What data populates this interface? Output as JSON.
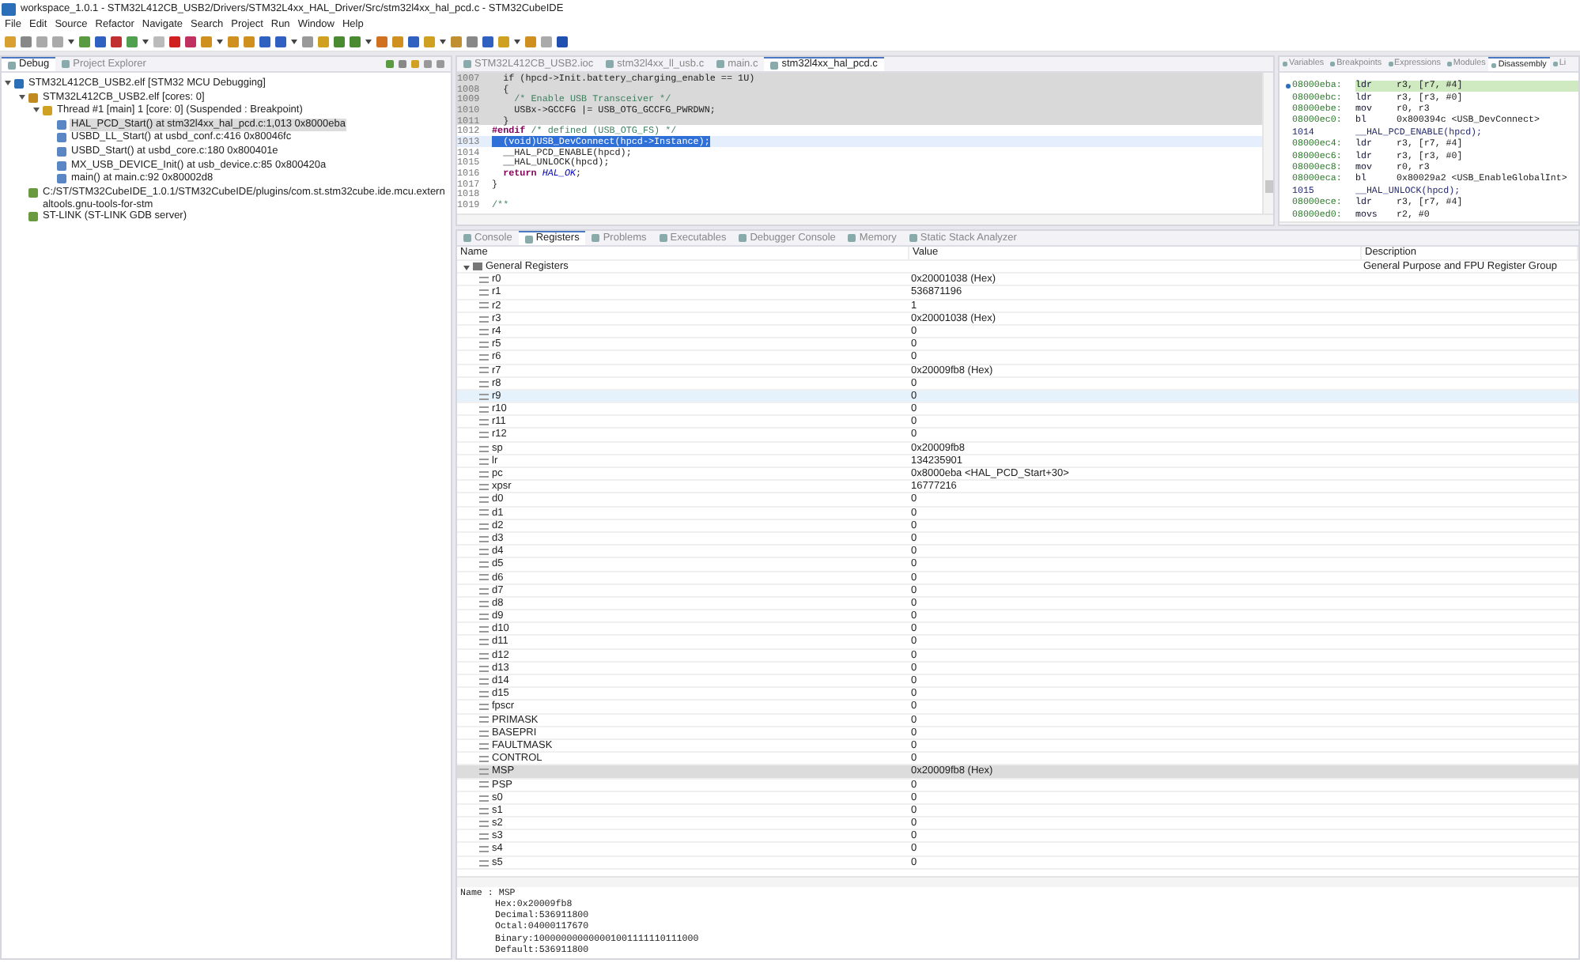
{
  "window": {
    "title": "workspace_1.0.1 - STM32L412CB_USB2/Drivers/STM32L4xx_HAL_Driver/Src/stm32l4xx_hal_pcd.c - STM32CubeIDE"
  },
  "menu": [
    "File",
    "Edit",
    "Source",
    "Refactor",
    "Navigate",
    "Search",
    "Project",
    "Run",
    "Window",
    "Help"
  ],
  "debug_view": {
    "tabs": [
      {
        "label": "Debug",
        "selected": true
      },
      {
        "label": "Project Explorer",
        "selected": false
      }
    ],
    "tree": [
      {
        "label": "STM32L412CB_USB2.elf [STM32 MCU Debugging]",
        "kind": "launch",
        "expanded": true,
        "selected": false,
        "children": [
          {
            "label": "STM32L412CB_USB2.elf [cores: 0]",
            "kind": "process",
            "expanded": true,
            "selected": false,
            "children": [
              {
                "label": "Thread #1 [main] 1 [core: 0] (Suspended : Breakpoint)",
                "kind": "thread",
                "expanded": true,
                "selected": false,
                "children": [
                  {
                    "label": "HAL_PCD_Start() at stm32l4xx_hal_pcd.c:1,013 0x8000eba",
                    "kind": "frame",
                    "selected": true
                  },
                  {
                    "label": "USBD_LL_Start() at usbd_conf.c:416 0x80046fc",
                    "kind": "frame",
                    "selected": false
                  },
                  {
                    "label": "USBD_Start() at usbd_core.c:180 0x800401e",
                    "kind": "frame",
                    "selected": false
                  },
                  {
                    "label": "MX_USB_DEVICE_Init() at usb_device.c:85 0x800420a",
                    "kind": "frame",
                    "selected": false
                  },
                  {
                    "label": "main() at main.c:92 0x80002d8",
                    "kind": "frame",
                    "selected": false
                  }
                ]
              }
            ]
          },
          {
            "label": "C:/ST/STM32CubeIDE_1.0.1/STM32CubeIDE/plugins/com.st.stm32cube.ide.mcu.externaltools.gnu-tools-for-stm",
            "kind": "tool",
            "selected": false
          },
          {
            "label": "ST-LINK (ST-LINK GDB server)",
            "kind": "tool",
            "selected": false
          }
        ]
      }
    ]
  },
  "editor": {
    "tabs": [
      {
        "label": "STM32L412CB_USB2.ioc",
        "selected": false
      },
      {
        "label": "stm32l4xx_ll_usb.c",
        "selected": false
      },
      {
        "label": "main.c",
        "selected": false
      },
      {
        "label": "stm32l4xx_hal_pcd.c",
        "selected": true
      }
    ],
    "lines": [
      {
        "number": "1007",
        "inactive": true,
        "current": false,
        "selected": false,
        "tokens": [
          {
            "text": "  if (hpcd->Init.battery_charging_enable == 1U)",
            "kind": "plain"
          }
        ]
      },
      {
        "number": "1008",
        "inactive": true,
        "current": false,
        "selected": false,
        "tokens": [
          {
            "text": "  {",
            "kind": "plain"
          }
        ]
      },
      {
        "number": "1009",
        "inactive": true,
        "current": false,
        "selected": false,
        "tokens": [
          {
            "text": "    /* Enable USB Transceiver */",
            "kind": "comment"
          }
        ]
      },
      {
        "number": "1010",
        "inactive": true,
        "current": false,
        "selected": false,
        "tokens": [
          {
            "text": "    USBx->GCCFG |= USB_OTG_GCCFG_PWRDWN;",
            "kind": "plain"
          }
        ]
      },
      {
        "number": "1011",
        "inactive": true,
        "current": false,
        "selected": false,
        "tokens": [
          {
            "text": "  }",
            "kind": "plain"
          }
        ]
      },
      {
        "number": "1012",
        "inactive": false,
        "current": false,
        "selected": false,
        "tokens": [
          {
            "text": "#endif",
            "kind": "keyword"
          },
          {
            "text": " /* defined (USB_OTG_FS) */",
            "kind": "comment"
          }
        ]
      },
      {
        "number": "1013",
        "inactive": false,
        "current": true,
        "selected": true,
        "tokens": [
          {
            "text": "  (void)USB_DevConnect(hpcd->Instance);",
            "kind": "plain"
          }
        ]
      },
      {
        "number": "1014",
        "inactive": false,
        "current": false,
        "selected": false,
        "tokens": [
          {
            "text": "  __HAL_PCD_ENABLE(hpcd);",
            "kind": "plain"
          }
        ]
      },
      {
        "number": "1015",
        "inactive": false,
        "current": false,
        "selected": false,
        "tokens": [
          {
            "text": "  __HAL_UNLOCK(hpcd);",
            "kind": "plain"
          }
        ]
      },
      {
        "number": "1016",
        "inactive": false,
        "current": false,
        "selected": false,
        "tokens": [
          {
            "text": "  return ",
            "kind": "keyword"
          },
          {
            "text": "HAL_OK",
            "kind": "constant"
          },
          {
            "text": ";",
            "kind": "plain"
          }
        ]
      },
      {
        "number": "1017",
        "inactive": false,
        "current": false,
        "selected": false,
        "tokens": [
          {
            "text": "}",
            "kind": "plain"
          }
        ]
      },
      {
        "number": "1018",
        "inactive": false,
        "current": false
      },
      {
        "number": "1019",
        "inactive": false,
        "current": false,
        "selected": false,
        "tokens": [
          {
            "text": "/**",
            "kind": "comment"
          }
        ]
      }
    ]
  },
  "disassembly_view": {
    "tabs": [
      {
        "label": "Variables",
        "selected": false
      },
      {
        "label": "Breakpoints",
        "selected": false
      },
      {
        "label": "Expressions",
        "selected": false
      },
      {
        "label": "Modules",
        "selected": false
      },
      {
        "label": "Disassembly",
        "selected": true
      },
      {
        "label": "Li",
        "selected": false
      }
    ],
    "rows": [
      {
        "kind": "instruction",
        "address": "08000eba:",
        "mnemonic": "ldr",
        "operands": "r3, [r7, #4]",
        "current": true
      },
      {
        "kind": "instruction",
        "address": "08000ebc:",
        "mnemonic": "ldr",
        "operands": "r3, [r3, #0]",
        "current": false
      },
      {
        "kind": "instruction",
        "address": "08000ebe:",
        "mnemonic": "mov",
        "operands": "r0, r3",
        "current": false
      },
      {
        "kind": "instruction",
        "address": "08000ec0:",
        "mnemonic": "bl",
        "operands": "0x800394c <USB_DevConnect>",
        "current": false
      },
      {
        "kind": "source",
        "line": "1014",
        "text": "__HAL_PCD_ENABLE(hpcd);"
      },
      {
        "kind": "instruction",
        "address": "08000ec4:",
        "mnemonic": "ldr",
        "operands": "r3, [r7, #4]",
        "current": false
      },
      {
        "kind": "instruction",
        "address": "08000ec6:",
        "mnemonic": "ldr",
        "operands": "r3, [r3, #0]",
        "current": false
      },
      {
        "kind": "instruction",
        "address": "08000ec8:",
        "mnemonic": "mov",
        "operands": "r0, r3",
        "current": false
      },
      {
        "kind": "instruction",
        "address": "08000eca:",
        "mnemonic": "bl",
        "operands": "0x80029a2 <USB_EnableGlobalInt>",
        "current": false
      },
      {
        "kind": "source",
        "line": "1015",
        "text": "__HAL_UNLOCK(hpcd);"
      },
      {
        "kind": "instruction",
        "address": "08000ece:",
        "mnemonic": "ldr",
        "operands": "r3, [r7, #4]",
        "current": false
      },
      {
        "kind": "instruction",
        "address": "08000ed0:",
        "mnemonic": "movs",
        "operands": "r2, #0",
        "current": false
      }
    ]
  },
  "bottom_view": {
    "tabs": [
      {
        "label": "Console",
        "selected": false
      },
      {
        "label": "Registers",
        "selected": true
      },
      {
        "label": "Problems",
        "selected": false
      },
      {
        "label": "Executables",
        "selected": false
      },
      {
        "label": "Debugger Console",
        "selected": false
      },
      {
        "label": "Memory",
        "selected": false
      },
      {
        "label": "Static Stack Analyzer",
        "selected": false
      }
    ],
    "columns": [
      "Name",
      "Value",
      "Description"
    ],
    "group": {
      "name": "General Registers",
      "description": "General Purpose and FPU Register Group",
      "expanded": true
    },
    "registers": [
      {
        "name": "r0",
        "value": "0x20001038 (Hex)",
        "selected": false,
        "hovered": false
      },
      {
        "name": "r1",
        "value": "536871196",
        "selected": false,
        "hovered": false
      },
      {
        "name": "r2",
        "value": "1",
        "selected": false,
        "hovered": false
      },
      {
        "name": "r3",
        "value": "0x20001038 (Hex)",
        "selected": false,
        "hovered": false
      },
      {
        "name": "r4",
        "value": "0",
        "selected": false,
        "hovered": false
      },
      {
        "name": "r5",
        "value": "0",
        "selected": false,
        "hovered": false
      },
      {
        "name": "r6",
        "value": "0",
        "selected": false,
        "hovered": false
      },
      {
        "name": "r7",
        "value": "0x20009fb8 (Hex)",
        "selected": false,
        "hovered": false
      },
      {
        "name": "r8",
        "value": "0",
        "selected": false,
        "hovered": false
      },
      {
        "name": "r9",
        "value": "0",
        "selected": false,
        "hovered": true
      },
      {
        "name": "r10",
        "value": "0",
        "selected": false,
        "hovered": false
      },
      {
        "name": "r11",
        "value": "0",
        "selected": false,
        "hovered": false
      },
      {
        "name": "r12",
        "value": "0",
        "selected": false,
        "hovered": false
      },
      {
        "name": "sp",
        "value": "0x20009fb8",
        "selected": false,
        "hovered": false
      },
      {
        "name": "lr",
        "value": "134235901",
        "selected": false,
        "hovered": false
      },
      {
        "name": "pc",
        "value": "0x8000eba <HAL_PCD_Start+30>",
        "selected": false,
        "hovered": false
      },
      {
        "name": "xpsr",
        "value": "16777216",
        "selected": false,
        "hovered": false
      },
      {
        "name": "d0",
        "value": "0",
        "selected": false,
        "hovered": false
      },
      {
        "name": "d1",
        "value": "0",
        "selected": false,
        "hovered": false
      },
      {
        "name": "d2",
        "value": "0",
        "selected": false,
        "hovered": false
      },
      {
        "name": "d3",
        "value": "0",
        "selected": false,
        "hovered": false
      },
      {
        "name": "d4",
        "value": "0",
        "selected": false,
        "hovered": false
      },
      {
        "name": "d5",
        "value": "0",
        "selected": false,
        "hovered": false
      },
      {
        "name": "d6",
        "value": "0",
        "selected": false,
        "hovered": false
      },
      {
        "name": "d7",
        "value": "0",
        "selected": false,
        "hovered": false
      },
      {
        "name": "d8",
        "value": "0",
        "selected": false,
        "hovered": false
      },
      {
        "name": "d9",
        "value": "0",
        "selected": false,
        "hovered": false
      },
      {
        "name": "d10",
        "value": "0",
        "selected": false,
        "hovered": false
      },
      {
        "name": "d11",
        "value": "0",
        "selected": false,
        "hovered": false
      },
      {
        "name": "d12",
        "value": "0",
        "selected": false,
        "hovered": false
      },
      {
        "name": "d13",
        "value": "0",
        "selected": false,
        "hovered": false
      },
      {
        "name": "d14",
        "value": "0",
        "selected": false,
        "hovered": false
      },
      {
        "name": "d15",
        "value": "0",
        "selected": false,
        "hovered": false
      },
      {
        "name": "fpscr",
        "value": "0",
        "selected": false,
        "hovered": false
      },
      {
        "name": "PRIMASK",
        "value": "0",
        "selected": false,
        "hovered": false
      },
      {
        "name": "BASEPRI",
        "value": "0",
        "selected": false,
        "hovered": false
      },
      {
        "name": "FAULTMASK",
        "value": "0",
        "selected": false,
        "hovered": false
      },
      {
        "name": "CONTROL",
        "value": "0",
        "selected": false,
        "hovered": false
      },
      {
        "name": "MSP",
        "value": "0x20009fb8 (Hex)",
        "selected": true,
        "hovered": false
      },
      {
        "name": "PSP",
        "value": "0",
        "selected": false,
        "hovered": false
      },
      {
        "name": "s0",
        "value": "0",
        "selected": false,
        "hovered": false
      },
      {
        "name": "s1",
        "value": "0",
        "selected": false,
        "hovered": false
      },
      {
        "name": "s2",
        "value": "0",
        "selected": false,
        "hovered": false
      },
      {
        "name": "s3",
        "value": "0",
        "selected": false,
        "hovered": false
      },
      {
        "name": "s4",
        "value": "0",
        "selected": false,
        "hovered": false
      },
      {
        "name": "s5",
        "value": "0",
        "selected": false,
        "hovered": false
      }
    ],
    "details": [
      "Name : MSP",
      "Hex:0x20009fb8",
      "Decimal:536911800",
      "Octal:04000117670",
      "Binary:100000000000001001111110111000",
      "Default:536911800"
    ]
  }
}
